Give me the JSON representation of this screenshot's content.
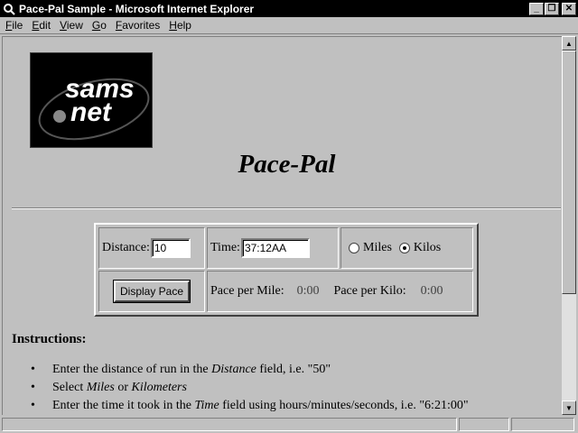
{
  "window": {
    "title": "Pace-Pal Sample - Microsoft Internet Explorer",
    "controls": [
      "_",
      "❐",
      "✕"
    ]
  },
  "menu": [
    {
      "u": "F",
      "rest": "ile"
    },
    {
      "u": "E",
      "rest": "dit"
    },
    {
      "u": "V",
      "rest": "iew"
    },
    {
      "u": "G",
      "rest": "o"
    },
    {
      "u": "F",
      "rest": "avorites"
    },
    {
      "u": "H",
      "rest": "elp"
    }
  ],
  "logo": {
    "line1": "sams",
    "line2": "net"
  },
  "page": {
    "title": "Pace-Pal"
  },
  "form": {
    "distance_label": "Distance:",
    "distance_value": "10",
    "time_label": "Time:",
    "time_value": "37:12AA",
    "miles_label": "Miles",
    "kilos_label": "Kilos",
    "selected_unit": "Kilos",
    "display_button": "Display Pace",
    "pace_mile_label": "Pace per Mile:",
    "pace_mile_value": "0:00",
    "pace_kilo_label": "Pace per Kilo:",
    "pace_kilo_value": "0:00"
  },
  "instructions": {
    "title": "Instructions:",
    "bullet": "•",
    "item1_a": "Enter the distance of run in the ",
    "item1_em": "Distance",
    "item1_b": " field, i.e. \"50\"",
    "item2_a": "Select ",
    "item2_em1": "Miles",
    "item2_mid": " or ",
    "item2_em2": "Kilometers",
    "item3_a": "Enter the time it took in the ",
    "item3_em": "Time",
    "item3_b": " field using hours/minutes/seconds, i.e. \"6:21:00\""
  },
  "colors": {
    "face": "#c0c0c0",
    "titlebar": "#000000",
    "window": "#ffffff"
  }
}
